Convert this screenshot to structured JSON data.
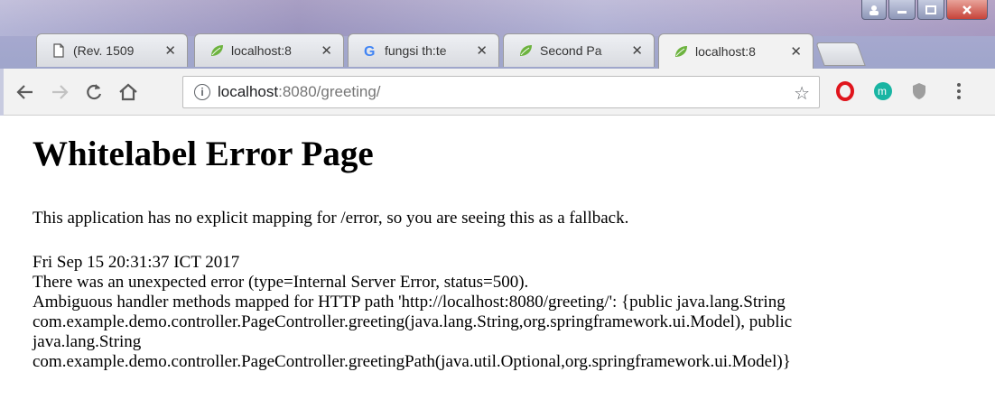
{
  "tabs": [
    {
      "title": "(Rev. 1509",
      "favicon": "document-icon"
    },
    {
      "title": "localhost:8",
      "favicon": "spring-leaf-icon"
    },
    {
      "title": "fungsi th:te",
      "favicon": "google-icon"
    },
    {
      "title": "Second Pa",
      "favicon": "spring-leaf-icon"
    },
    {
      "title": "localhost:8",
      "favicon": "spring-leaf-icon",
      "active": true
    }
  ],
  "tab_close_glyph": "✕",
  "address_bar": {
    "url_host": "localhost",
    "url_rest": ":8080/greeting/"
  },
  "page": {
    "heading": "Whitelabel Error Page",
    "intro": "This application has no explicit mapping for /error, so you are seeing this as a fallback.",
    "timestamp": "Fri Sep 15 20:31:37 ICT 2017",
    "error_line": "There was an unexpected error (type=Internal Server Error, status=500).",
    "message_line1": "Ambiguous handler methods mapped for HTTP path 'http://localhost:8080/greeting/': {public java.lang.String",
    "message_line2": "com.example.demo.controller.PageController.greeting(java.lang.String,org.springframework.ui.Model), public",
    "message_line3": "java.lang.String",
    "message_line4": "com.example.demo.controller.PageController.greetingPath(java.util.Optional,org.springframework.ui.Model)}"
  },
  "colors": {
    "spring_green": "#6db33f",
    "opera_red": "#e0151d",
    "mercury_teal": "#19b5a3"
  }
}
